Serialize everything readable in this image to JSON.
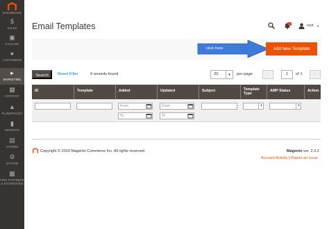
{
  "sidebar": {
    "items": [
      {
        "label": "DASHBOARD",
        "icon": "speedometer-icon"
      },
      {
        "label": "SALES",
        "icon": "dollar-icon"
      },
      {
        "label": "CATALOG",
        "icon": "box-icon"
      },
      {
        "label": "CUSTOMERS",
        "icon": "user-icon"
      },
      {
        "label": "MARKETING",
        "icon": "megaphone-icon"
      },
      {
        "label": "CONTENT",
        "icon": "layout-icon"
      },
      {
        "label": "PLUMROCKET",
        "icon": "plumrocket-icon"
      },
      {
        "label": "REPORTS",
        "icon": "bar-chart-icon"
      },
      {
        "label": "STORES",
        "icon": "store-icon"
      },
      {
        "label": "SYSTEM",
        "icon": "gear-icon"
      },
      {
        "label": "FIND PARTNERS",
        "label2": "& EXTENSIONS",
        "icon": "partners-icon"
      }
    ],
    "active": "MARKETING"
  },
  "header": {
    "title": "Email Templates",
    "notification_count": "2",
    "user_name": "root"
  },
  "actions": {
    "add_label": "Add New Template",
    "callout_text": "click here"
  },
  "toolbar": {
    "search_label": "Search",
    "reset_label": "Reset Filter",
    "records": "0 records found",
    "per_page_value": "20",
    "per_page_label": "per page",
    "page_value": "1",
    "page_of": "of 1"
  },
  "grid": {
    "columns": [
      "ID",
      "Template",
      "Added",
      "Updated",
      "Subject",
      "Template Type",
      "AMP Status",
      "Action"
    ],
    "from_placeholder": "From",
    "to_placeholder": "To"
  },
  "footer": {
    "copyright": "Copyright © 2019 Magento Commerce Inc. All rights reserved.",
    "brand": "Magento",
    "version": "ver. 2.3.2",
    "activity_link": "Account Activity",
    "separator": "|",
    "report_link": "Report an Issue"
  },
  "colors": {
    "accent": "#eb5202",
    "sidebar": "#373330",
    "grid_header": "#514943",
    "callout": "#3d7bd9"
  }
}
